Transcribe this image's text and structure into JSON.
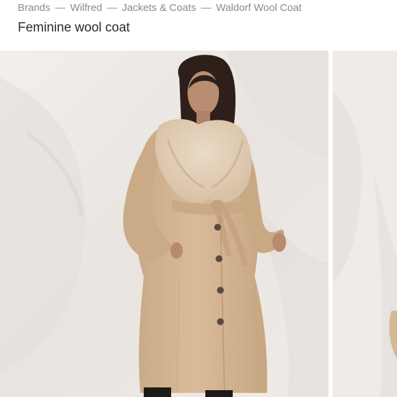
{
  "breadcrumb": {
    "items": [
      "Brands",
      "Wilfred",
      "Jackets & Coats",
      "Waldorf Wool Coat"
    ],
    "separator": "—"
  },
  "product": {
    "title": "Feminine wool coat"
  },
  "colors": {
    "breadcrumb_text": "#8a8a8a",
    "title_text": "#2b2b2b",
    "coat": "#d6b896",
    "fur": "#e3cdb3",
    "backdrop": "#efebe8"
  },
  "gallery": {
    "images": [
      "model-wearing-camel-wool-coat-front",
      "model-wearing-camel-wool-coat-next"
    ]
  }
}
